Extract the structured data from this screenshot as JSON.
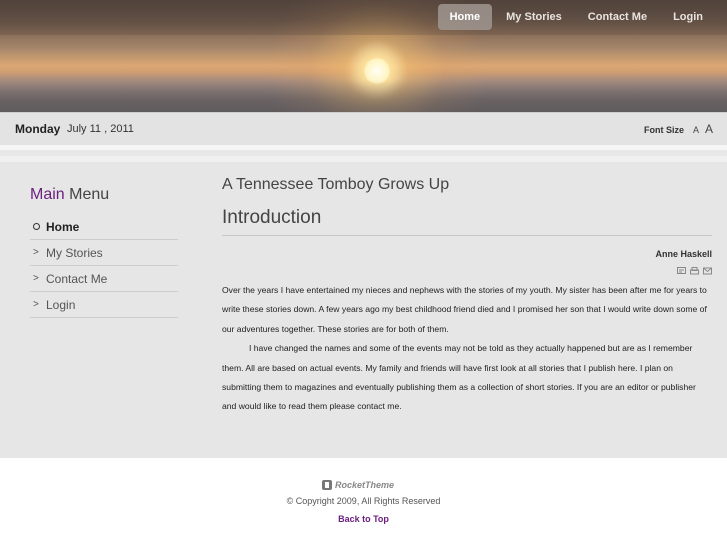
{
  "nav": {
    "items": [
      {
        "label": "Home",
        "active": true
      },
      {
        "label": "My Stories",
        "active": false
      },
      {
        "label": "Contact Me",
        "active": false
      },
      {
        "label": "Login",
        "active": false
      }
    ]
  },
  "datebar": {
    "day": "Monday",
    "date": "July 11 , 2011",
    "font_size_label": "Font Size",
    "small_a": "A",
    "large_a": "A"
  },
  "sidebar": {
    "title_accent": "Main",
    "title_rest": " Menu",
    "items": [
      {
        "label": "Home",
        "active": true
      },
      {
        "label": "My Stories",
        "active": false
      },
      {
        "label": "Contact Me",
        "active": false
      },
      {
        "label": "Login",
        "active": false
      }
    ]
  },
  "content": {
    "site_title": "A Tennessee Tomboy Grows Up",
    "page_title": "Introduction",
    "author": "Anne Haskell",
    "tools": [
      "pdf-icon",
      "print-icon",
      "email-icon"
    ],
    "paragraphs": [
      "Over the years I have entertained my nieces and nephews with the stories of my youth. My sister has been after me for years to write these stories down. A few years ago my best childhood friend died and I promised her son that I would write down some of our adventures together. These stories are for both of them.",
      "I have changed the names and some of the events may not be told as they actually happened but are as I remember them. All are based on actual events. My family and friends will have first look at all stories that I publish here. I plan on submitting them to magazines and eventually publishing them as a collection of short stories. If you are an editor or publisher and would like to read them please contact me."
    ]
  },
  "footer": {
    "logo_text": "RocketTheme",
    "copyright": "© Copyright 2009, All Rights Reserved",
    "back_to_top": "Back to Top"
  },
  "colors": {
    "accent": "#6b2080",
    "main_bg": "#e6e6e6"
  }
}
